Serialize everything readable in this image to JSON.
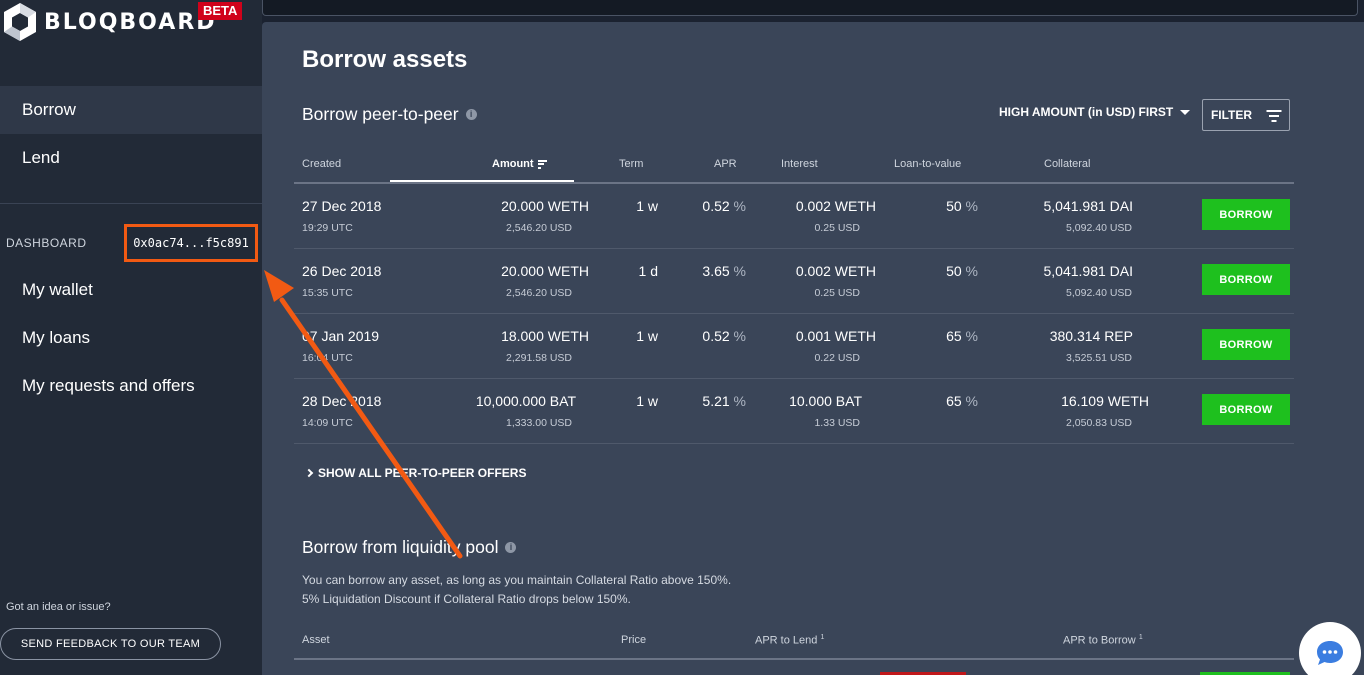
{
  "brand": {
    "name": "BLOQBOARD",
    "badge": "BETA"
  },
  "search": {
    "value": "",
    "placeholder": ""
  },
  "sidebar": {
    "nav": [
      {
        "label": "Borrow"
      },
      {
        "label": "Lend"
      }
    ],
    "dashboard_label": "DASHBOARD",
    "address": "0x0ac74...f5c891",
    "dashboard_items": [
      {
        "label": "My wallet"
      },
      {
        "label": "My loans"
      },
      {
        "label": "My requests and offers"
      }
    ],
    "idea_text": "Got an idea or issue?",
    "feedback_label": "SEND FEEDBACK TO OUR TEAM"
  },
  "main": {
    "title": "Borrow assets",
    "p2p": {
      "title": "Borrow peer-to-peer",
      "sort_label": "HIGH AMOUNT (in USD) FIRST",
      "filter_label": "FILTER",
      "columns": [
        "Created",
        "Amount",
        "Term",
        "APR",
        "Interest",
        "Loan-to-value",
        "Collateral"
      ],
      "rows": [
        {
          "date": "27 Dec 2018",
          "time": "19:29 UTC",
          "amount": "20.000 WETH",
          "amount_usd": "2,546.20 USD",
          "term": "1 w",
          "apr": "0.52",
          "interest": "0.002 WETH",
          "interest_usd": "0.25 USD",
          "ltv": "50",
          "collateral": "5,041.981 DAI",
          "collateral_usd": "5,092.40 USD",
          "button": "BORROW"
        },
        {
          "date": "26 Dec 2018",
          "time": "15:35 UTC",
          "amount": "20.000 WETH",
          "amount_usd": "2,546.20 USD",
          "term": "1 d",
          "apr": "3.65",
          "interest": "0.002 WETH",
          "interest_usd": "0.25 USD",
          "ltv": "50",
          "collateral": "5,041.981 DAI",
          "collateral_usd": "5,092.40 USD",
          "button": "BORROW"
        },
        {
          "date": "07 Jan 2019",
          "time": "16:04 UTC",
          "amount": "18.000 WETH",
          "amount_usd": "2,291.58 USD",
          "term": "1 w",
          "apr": "0.52",
          "interest": "0.001 WETH",
          "interest_usd": "0.22 USD",
          "ltv": "65",
          "collateral": "380.314 REP",
          "collateral_usd": "3,525.51 USD",
          "button": "BORROW"
        },
        {
          "date": "28 Dec 2018",
          "time": "14:09 UTC",
          "amount": "10,000.000 BAT",
          "amount_usd": "1,333.00 USD",
          "term": "1 w",
          "apr": "5.21",
          "interest": "10.000 BAT",
          "interest_usd": "1.33 USD",
          "ltv": "65",
          "collateral": "16.109 WETH",
          "collateral_usd": "2,050.83 USD",
          "button": "BORROW"
        }
      ],
      "percent_unit": "%",
      "show_all_label": "SHOW ALL PEER-TO-PEER OFFERS"
    },
    "pool": {
      "title": "Borrow from liquidity pool",
      "desc_line1": "You can borrow any asset, as long as you maintain Collateral Ratio above 150%.",
      "desc_line2": "5% Liquidation Discount if Collateral Ratio drops below 150%.",
      "columns": [
        "Asset",
        "Price",
        "APR to Lend",
        "APR to Borrow"
      ],
      "footnote_mark": "1"
    }
  },
  "colors": {
    "accent_orange": "#f25a13",
    "borrow_green": "#1ec01e",
    "beta_red": "#d0021b",
    "panel": "#3a4558",
    "sidebar": "#222a37"
  },
  "icons": {
    "logo": "bloqboard-hexagon-logo",
    "info": "info-icon",
    "sort": "sort-desc-icon",
    "filter": "filter-icon",
    "chat": "chat-bubble-icon"
  }
}
